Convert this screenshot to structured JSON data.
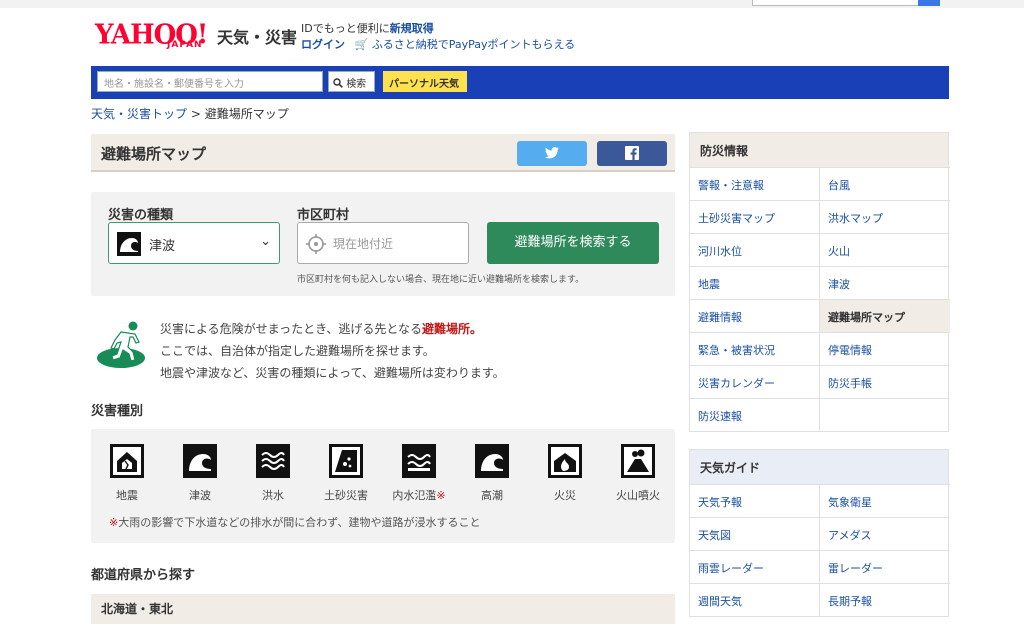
{
  "header": {
    "logo_text": "YAHOO!",
    "logo_sub": "JAPAN",
    "site_title": "天気・災害",
    "promo_prefix": "IDでもっと便利に",
    "promo_link": "新規取得",
    "login": "ログイン",
    "furusato": "ふるさと納税でPayPayポイントもらえる"
  },
  "search": {
    "placeholder": "地名・施設名・郵便番号を入力",
    "button": "検索",
    "personal": "パーソナル天気"
  },
  "breadcrumb": {
    "home": "天気・災害トップ",
    "sep": ">",
    "current": "避難場所マップ"
  },
  "page": {
    "title": "避難場所マップ"
  },
  "form": {
    "type_label": "災害の種類",
    "type_value": "津波",
    "city_label": "市区町村",
    "city_placeholder": "現在地付近",
    "submit": "避難場所を検索する",
    "note": "市区町村を何も記入しない場合、現在地に近い避難場所を検索します。"
  },
  "intro": {
    "line1_prefix": "災害による危険がせまったとき、逃げる先となる",
    "line1_highlight": "避難場所。",
    "line2": "ここでは、自治体が指定した避難場所を探せます。",
    "line3": "地震や津波など、災害の種類によって、避難場所は変わります。"
  },
  "types": {
    "heading": "災害種別",
    "items": [
      {
        "label": "地震",
        "mark": ""
      },
      {
        "label": "津波",
        "mark": ""
      },
      {
        "label": "洪水",
        "mark": ""
      },
      {
        "label": "土砂災害",
        "mark": ""
      },
      {
        "label": "内水氾濫",
        "mark": "※"
      },
      {
        "label": "高潮",
        "mark": ""
      },
      {
        "label": "火災",
        "mark": ""
      },
      {
        "label": "火山噴火",
        "mark": ""
      }
    ],
    "footnote_mark": "※",
    "footnote": "大雨の影響で下水道などの排水が間に合わず、建物や道路が浸水すること"
  },
  "prefecture": {
    "heading": "都道府県から探す",
    "region": "北海道・東北"
  },
  "sidebar": {
    "disaster_title": "防災情報",
    "disaster_items": [
      "警報・注意報",
      "台風",
      "土砂災害マップ",
      "洪水マップ",
      "河川水位",
      "火山",
      "地震",
      "津波",
      "避難情報",
      "避難場所マップ",
      "緊急・被害状況",
      "停電情報",
      "災害カレンダー",
      "防災手帳",
      "防災速報",
      ""
    ],
    "disaster_active": "避難場所マップ",
    "weather_title": "天気ガイド",
    "weather_items": [
      "天気予報",
      "気象衛星",
      "天気図",
      "アメダス",
      "雨雲レーダー",
      "雷レーダー",
      "週間天気",
      "長期予報"
    ]
  }
}
